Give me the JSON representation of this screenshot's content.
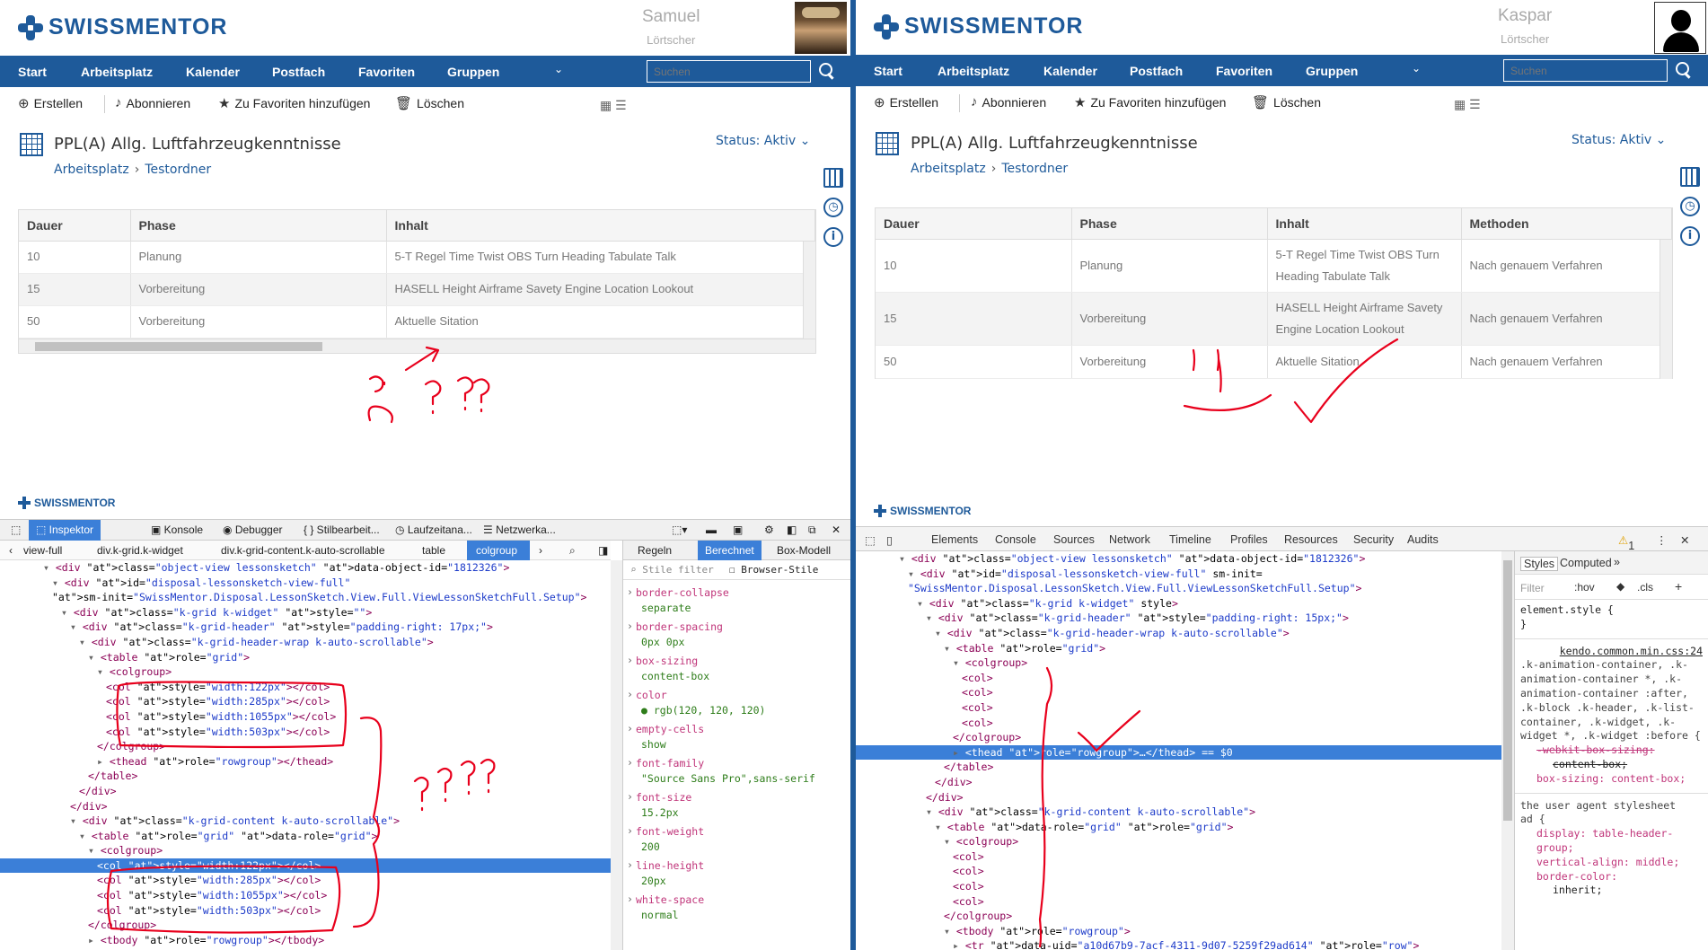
{
  "left": {
    "logo": "SWISSMENTOR",
    "user": {
      "first": "Samuel",
      "last": "Lörtscher"
    },
    "nav": [
      "Start",
      "Arbeitsplatz",
      "Kalender",
      "Postfach",
      "Favoriten",
      "Gruppen"
    ],
    "search_placeholder": "Suchen",
    "toolbar": [
      "Erstellen",
      "Abonnieren",
      "Zu Favoriten hinzufügen",
      "Löschen"
    ],
    "title": "PPL(A) Allg. Luftfahrzeugkenntnisse",
    "breadcrumb": [
      "Arbeitsplatz",
      "Testordner"
    ],
    "status": "Status: Aktiv",
    "columns": [
      "Dauer",
      "Phase",
      "Inhalt"
    ],
    "rows": [
      [
        "10",
        "Planung",
        "5-T Regel Time Twist OBS Turn Heading Tabulate Talk"
      ],
      [
        "15",
        "Vorbereitung",
        "HASELL Height Airframe Savety Engine Location Lookout"
      ],
      [
        "50",
        "Vorbereitung",
        "Aktuelle Sitation"
      ]
    ],
    "devtools": {
      "logo": "SWISSMENTOR",
      "tabs": [
        "Inspektor",
        "Konsole",
        "Debugger",
        "{ } Stilbearbeit...",
        "Laufzeitana...",
        "Netzwerka..."
      ],
      "breadcrumbs": [
        "view-full",
        "div.k-grid.k-widget",
        "div.k-grid-content.k-auto-scrollable",
        "table",
        "colgroup"
      ],
      "right_tabs": [
        "Regeln",
        "Berechnet",
        "Box-Modell"
      ],
      "filter": "Stile filter",
      "browser_styles": "Browser-Stile",
      "props": [
        [
          "border-collapse",
          "separate"
        ],
        [
          "border-spacing",
          "0px 0px"
        ],
        [
          "box-sizing",
          "content-box"
        ],
        [
          "color",
          "rgb(120, 120, 120)"
        ],
        [
          "empty-cells",
          "show"
        ],
        [
          "font-family",
          "\"Source Sans Pro\",sans-serif"
        ],
        [
          "font-size",
          "15.2px"
        ],
        [
          "font-weight",
          "200"
        ],
        [
          "line-height",
          "20px"
        ],
        [
          "white-space",
          "normal"
        ]
      ],
      "code": [
        "<div class=\"object-view lessonsketch\" data-object-id=\"1812326\">",
        "<div id=\"disposal-lessonsketch-view-full\"",
        "sm-init=\"SwissMentor.Disposal.LessonSketch.View.Full.ViewLessonSketchFull.Setup\">",
        "<div class=\"k-grid k-widget\" style=\"\">",
        "<div class=\"k-grid-header\" style=\"padding-right: 17px;\">",
        "<div class=\"k-grid-header-wrap k-auto-scrollable\">",
        "<table role=\"grid\">",
        "<colgroup>",
        "<col style=\"width:122px\"></col>",
        "<col style=\"width:285px\"></col>",
        "<col style=\"width:1055px\"></col>",
        "<col style=\"width:503px\"></col>",
        "</colgroup>",
        "<thead role=\"rowgroup\"></thead>",
        "</table>",
        "</div>",
        "</div>",
        "<div class=\"k-grid-content k-auto-scrollable\">",
        "<table role=\"grid\" data-role=\"grid\">",
        "<colgroup>",
        "<col style=\"width:122px\"></col>",
        "<col style=\"width:285px\"></col>",
        "<col style=\"width:1055px\"></col>",
        "<col style=\"width:503px\"></col>",
        "</colgroup>",
        "<tbody role=\"rowgroup\"></tbody>"
      ]
    }
  },
  "right": {
    "logo": "SWISSMENTOR",
    "user": {
      "first": "Kaspar",
      "last": "Lörtscher"
    },
    "nav": [
      "Start",
      "Arbeitsplatz",
      "Kalender",
      "Postfach",
      "Favoriten",
      "Gruppen"
    ],
    "search_placeholder": "Suchen",
    "toolbar": [
      "Erstellen",
      "Abonnieren",
      "Zu Favoriten hinzufügen",
      "Löschen"
    ],
    "title": "PPL(A) Allg. Luftfahrzeugkenntnisse",
    "breadcrumb": [
      "Arbeitsplatz",
      "Testordner"
    ],
    "status": "Status: Aktiv",
    "columns": [
      "Dauer",
      "Phase",
      "Inhalt",
      "Methoden"
    ],
    "rows": [
      [
        "10",
        "Planung",
        "5-T Regel Time Twist OBS Turn Heading Tabulate Talk",
        "Nach genauem Verfahren"
      ],
      [
        "15",
        "Vorbereitung",
        "HASELL Height Airframe Savety Engine Location Lookout",
        "Nach genauem Verfahren"
      ],
      [
        "50",
        "Vorbereitung",
        "Aktuelle Sitation",
        "Nach genauem Verfahren"
      ]
    ],
    "devtools": {
      "logo": "SWISSMENTOR",
      "tabs": [
        "Elements",
        "Console",
        "Sources",
        "Network",
        "Timeline",
        "Profiles",
        "Resources",
        "Security",
        "Audits"
      ],
      "warning_count": "1",
      "styles_tabs": [
        "Styles",
        "Computed"
      ],
      "filter": "Filter",
      "hov": ":hov",
      "cls": ".cls",
      "element_style": "element.style {",
      "source_link": "kendo.common.min.css:24",
      "selector": ".k-animation-container, .k-animation-container *, .k-animation-container :after, .k-block .k-header, .k-list-container, .k-widget, .k-widget *, .k-widget :before {",
      "strike1": "-webkit-box-sizing:",
      "strike2": "content-box;",
      "rule1": "box-sizing: content-box;",
      "ua_label": "the user agent stylesheet",
      "ua_selector": "ad {",
      "ua_rules": [
        "display: table-header-group;",
        "vertical-align: middle;",
        "border-color:",
        "inherit;"
      ],
      "code": [
        "<div class=\"object-view lessonsketch\" data-object-id=\"1812326\">",
        "<div id=\"disposal-lessonsketch-view-full\" sm-init=",
        "\"SwissMentor.Disposal.LessonSketch.View.Full.ViewLessonSketchFull.Setup\">",
        "<div class=\"k-grid k-widget\" style>",
        "<div class=\"k-grid-header\" style=\"padding-right: 15px;\">",
        "<div class=\"k-grid-header-wrap k-auto-scrollable\">",
        "<table role=\"grid\">",
        "<colgroup>",
        "<col>",
        "<col>",
        "<col>",
        "<col>",
        "</colgroup>",
        "<thead role=\"rowgroup\">…</thead> == $0",
        "</table>",
        "</div>",
        "</div>",
        "<div class=\"k-grid-content k-auto-scrollable\">",
        "<table data-role=\"grid\" role=\"grid\">",
        "<colgroup>",
        "<col>",
        "<col>",
        "<col>",
        "<col>",
        "</colgroup>",
        "<tbody role=\"rowgroup\">",
        "<tr data-uid=\"a10d67b9-7acf-4311-9d07-5259f29ad614\" role=\"row\">"
      ]
    }
  },
  "annotations": {
    "left_top": "?? ??",
    "left_bottom": "???"
  },
  "colors": {
    "brand": "#1e5a9a",
    "ink": "#e8001c",
    "selection": "#3b7fd8"
  }
}
